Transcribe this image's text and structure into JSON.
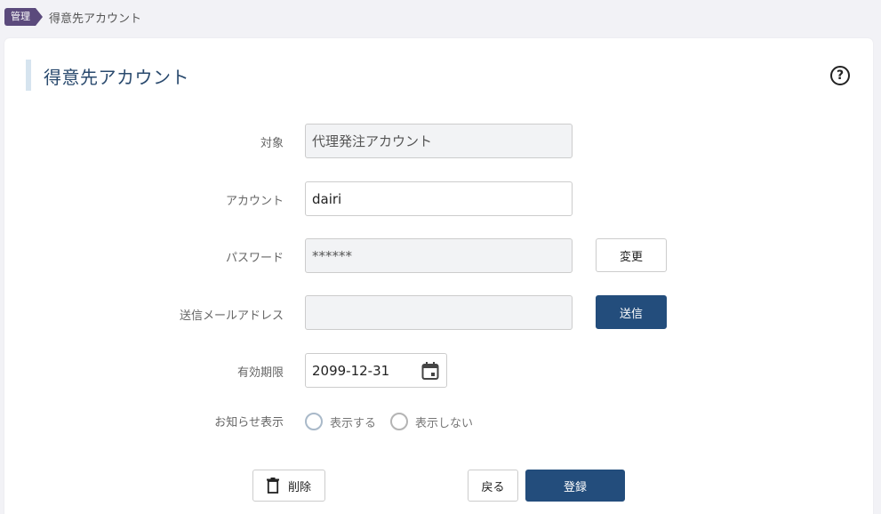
{
  "breadcrumb": {
    "tag": "管理",
    "current": "得意先アカウント"
  },
  "page": {
    "title": "得意先アカウント",
    "help_icon": "?"
  },
  "form": {
    "target_label": "対象",
    "target_value": "代理発注アカウント",
    "account_label": "アカウント",
    "account_value": "dairi",
    "password_label": "パスワード",
    "password_value": "******",
    "change_button": "変更",
    "email_label": "送信メールアドレス",
    "email_value": "",
    "send_button": "送信",
    "expiry_label": "有効期限",
    "expiry_value": "2099-12-31",
    "notice_label": "お知らせ表示",
    "notice_options": [
      "表示する",
      "表示しない"
    ]
  },
  "actions": {
    "delete": "削除",
    "back": "戻る",
    "register": "登録"
  },
  "colors": {
    "primary": "#234d7c",
    "breadcrumb_tag": "#5b4a7c",
    "title": "#2a4a6e"
  }
}
